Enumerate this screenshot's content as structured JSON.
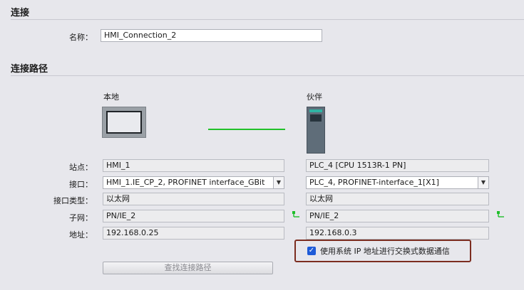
{
  "section1": {
    "heading": "连接",
    "name_label": "名称：",
    "name_value": "HMI_Connection_2"
  },
  "section2": {
    "heading": "连接路径"
  },
  "local": {
    "title": "本地",
    "station": "HMI_1",
    "interface": "HMI_1.IE_CP_2, PROFINET interface_GBit",
    "interface_type": "以太网",
    "subnet": "PN/IE_2",
    "address": "192.168.0.25"
  },
  "partner": {
    "title": "伙伴",
    "station": "PLC_4 [CPU 1513R-1 PN]",
    "interface": "PLC_4, PROFINET-interface_1[X1]",
    "interface_type": "以太网",
    "subnet": "PN/IE_2",
    "address": "192.168.0.3"
  },
  "labels": {
    "station": "站点：",
    "interface": "接口：",
    "interface_type": "接口类型：",
    "subnet": "子网：",
    "address": "地址："
  },
  "checkbox": {
    "label": "使用系统 IP 地址进行交换式数据通信",
    "checked": true
  },
  "find_button": {
    "label": "查找连接路径"
  },
  "colors": {
    "connection_line": "#22c12a",
    "checkbox_frame": "#7c2d20",
    "checkbox_fill": "#1e5bd8"
  },
  "icons": [
    "hmi-panel-icon",
    "plc-cpu-icon",
    "subnet-icon",
    "dropdown-arrow-icon",
    "checkmark-icon"
  ]
}
